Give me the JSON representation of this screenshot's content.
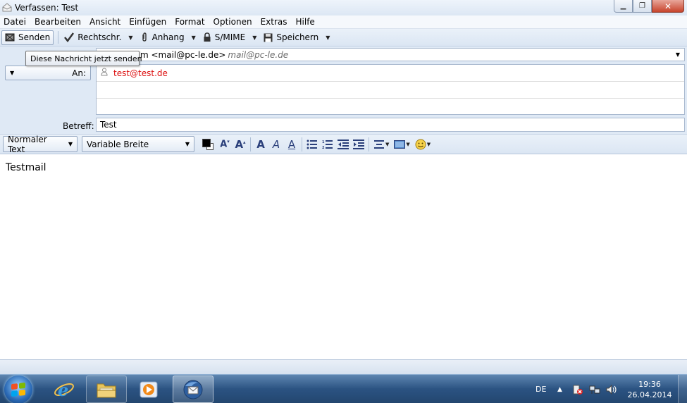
{
  "window": {
    "title": "Verfassen: Test"
  },
  "menubar": {
    "items": [
      "Datei",
      "Bearbeiten",
      "Ansicht",
      "Einfügen",
      "Format",
      "Optionen",
      "Extras",
      "Hilfe"
    ]
  },
  "toolbar": {
    "send_label": "Senden",
    "spell_label": "Rechtschr.",
    "attach_label": "Anhang",
    "smime_label": "S/MIME",
    "save_label": "Speichern"
  },
  "tooltip": {
    "text": "Diese Nachricht jetzt senden"
  },
  "header": {
    "from_address": "m <mail@pc-le.de>",
    "from_identity": "mail@pc-le.de",
    "to_label": "An:",
    "recipients": [
      "test@test.de",
      "",
      ""
    ],
    "subject_label": "Betreff:",
    "subject_value": "Test"
  },
  "format_toolbar": {
    "paragraph_style": "Normaler Text",
    "font": "Variable Breite"
  },
  "body": {
    "text": "Testmail"
  },
  "taskbar": {
    "language": "DE",
    "time": "19:36",
    "date": "26.04.2014"
  },
  "colors": {
    "recipient_text": "#dd1111",
    "taskbar": "#2b5382"
  }
}
